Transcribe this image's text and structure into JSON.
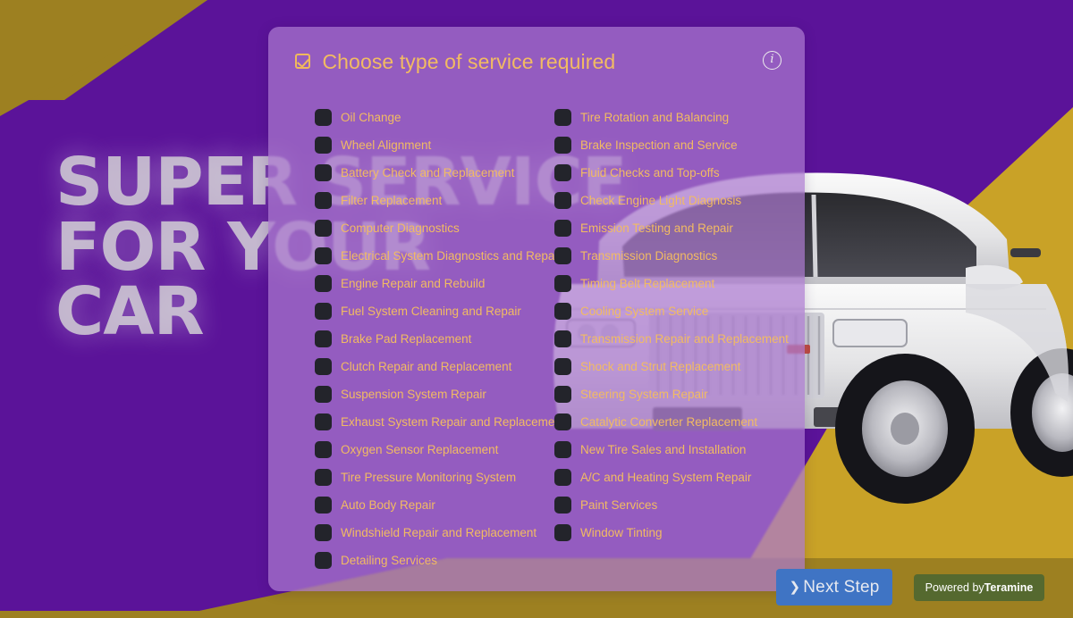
{
  "hero": {
    "headline": "SUPER SERVICE\nFOR YOUR\nCAR"
  },
  "colors": {
    "background_purple": "#5B1399",
    "accent_gold": "#9D8021",
    "wedge_gold": "#C9A227",
    "panel_fill": "#AA78CF",
    "label_gold": "#F2BB62",
    "checkbox_dark": "#23242B",
    "next_button_blue": "#3F74C4",
    "powered_badge_green": "#55692F"
  },
  "panel": {
    "title": "Choose type of service required",
    "title_check_icon": "checkbox-checked-icon",
    "info_icon": "info-circle-icon",
    "info_glyph": "i",
    "left_column": [
      "Oil Change",
      "Wheel Alignment",
      "Battery Check and Replacement",
      "Filter Replacement",
      "Computer Diagnostics",
      "Electrical System Diagnostics and Repair",
      "Engine Repair and Rebuild",
      "Fuel System Cleaning and Repair",
      "Brake Pad Replacement",
      "Clutch Repair and Replacement",
      "Suspension System Repair",
      "Exhaust System Repair and Replacement",
      "Oxygen Sensor Replacement",
      "Tire Pressure Monitoring System",
      "Auto Body Repair",
      "Windshield Repair and Replacement",
      "Detailing Services"
    ],
    "right_column": [
      "Tire Rotation and Balancing",
      "Brake Inspection and Service",
      "Fluid Checks and Top-offs",
      "Check Engine Light Diagnosis",
      "Emission Testing and Repair",
      "Transmission Diagnostics",
      "Timing Belt Replacement",
      "Cooling System Service",
      "Transmission Repair and Replacement",
      "Shock and Strut Replacement",
      "Steering System Repair",
      "Catalytic Converter Replacement",
      "New Tire Sales and Installation",
      "A/C and Heating System Repair",
      "Paint Services",
      "Window Tinting"
    ]
  },
  "footer": {
    "next_step_label": "Next Step",
    "next_step_chevron": "chevron-right-icon",
    "powered_prefix": "Powered by",
    "powered_brand": "Teramine"
  }
}
